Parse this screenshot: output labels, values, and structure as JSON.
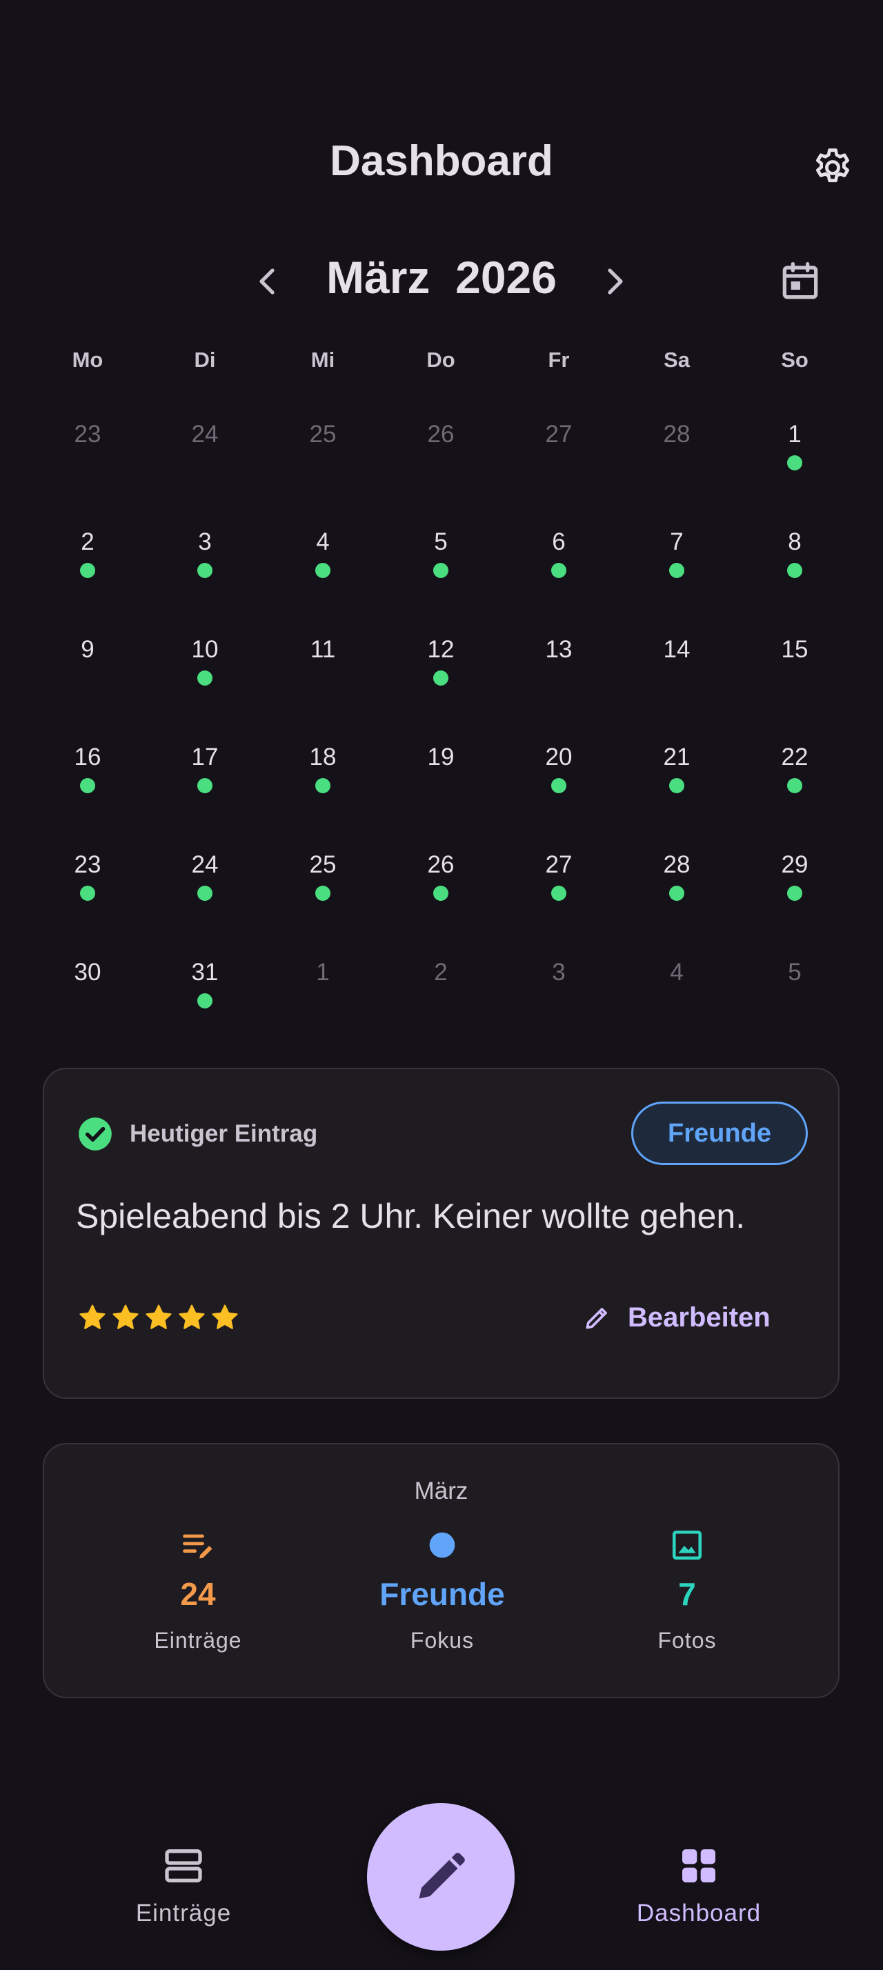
{
  "header": {
    "title": "Dashboard",
    "settings_icon": "gear-icon"
  },
  "month_nav": {
    "month": "März",
    "year": "2026",
    "prev_icon": "chevron-left-icon",
    "next_icon": "chevron-right-icon",
    "calendar_icon": "calendar-icon"
  },
  "calendar": {
    "weekdays": [
      "Mo",
      "Di",
      "Mi",
      "Do",
      "Fr",
      "Sa",
      "So"
    ],
    "entry_dot_color": "#4ade80",
    "weeks": [
      [
        {
          "d": "23",
          "other": true,
          "dot": false
        },
        {
          "d": "24",
          "other": true,
          "dot": false
        },
        {
          "d": "25",
          "other": true,
          "dot": false
        },
        {
          "d": "26",
          "other": true,
          "dot": false
        },
        {
          "d": "27",
          "other": true,
          "dot": false
        },
        {
          "d": "28",
          "other": true,
          "dot": false
        },
        {
          "d": "1",
          "other": false,
          "dot": true
        }
      ],
      [
        {
          "d": "2",
          "other": false,
          "dot": true
        },
        {
          "d": "3",
          "other": false,
          "dot": true
        },
        {
          "d": "4",
          "other": false,
          "dot": true
        },
        {
          "d": "5",
          "other": false,
          "dot": true
        },
        {
          "d": "6",
          "other": false,
          "dot": true
        },
        {
          "d": "7",
          "other": false,
          "dot": true
        },
        {
          "d": "8",
          "other": false,
          "dot": true
        }
      ],
      [
        {
          "d": "9",
          "other": false,
          "dot": false
        },
        {
          "d": "10",
          "other": false,
          "dot": true
        },
        {
          "d": "11",
          "other": false,
          "dot": false
        },
        {
          "d": "12",
          "other": false,
          "dot": true
        },
        {
          "d": "13",
          "other": false,
          "dot": false
        },
        {
          "d": "14",
          "other": false,
          "dot": false
        },
        {
          "d": "15",
          "other": false,
          "dot": false
        }
      ],
      [
        {
          "d": "16",
          "other": false,
          "dot": true
        },
        {
          "d": "17",
          "other": false,
          "dot": true
        },
        {
          "d": "18",
          "other": false,
          "dot": true
        },
        {
          "d": "19",
          "other": false,
          "dot": false
        },
        {
          "d": "20",
          "other": false,
          "dot": true
        },
        {
          "d": "21",
          "other": false,
          "dot": true
        },
        {
          "d": "22",
          "other": false,
          "dot": true
        }
      ],
      [
        {
          "d": "23",
          "other": false,
          "dot": true
        },
        {
          "d": "24",
          "other": false,
          "dot": true
        },
        {
          "d": "25",
          "other": false,
          "dot": true
        },
        {
          "d": "26",
          "other": false,
          "dot": true
        },
        {
          "d": "27",
          "other": false,
          "dot": true
        },
        {
          "d": "28",
          "other": false,
          "dot": true
        },
        {
          "d": "29",
          "other": false,
          "dot": true
        }
      ],
      [
        {
          "d": "30",
          "other": false,
          "dot": false
        },
        {
          "d": "31",
          "other": false,
          "dot": true
        },
        {
          "d": "1",
          "other": true,
          "dot": false
        },
        {
          "d": "2",
          "other": true,
          "dot": false
        },
        {
          "d": "3",
          "other": true,
          "dot": false
        },
        {
          "d": "4",
          "other": true,
          "dot": false
        },
        {
          "d": "5",
          "other": true,
          "dot": false
        }
      ]
    ]
  },
  "today_entry": {
    "header_label": "Heutiger Eintrag",
    "check_icon": "check-circle-icon",
    "tag": "Freunde",
    "text": "Spieleabend bis 2 Uhr. Keiner wollte gehen.",
    "rating": 5,
    "rating_max": 5,
    "edit_label": "Bearbeiten",
    "edit_icon": "pencil-icon"
  },
  "month_stats": {
    "title": "März",
    "items": [
      {
        "icon": "notes-edit-icon",
        "value": "24",
        "label": "Einträge",
        "color": "#f2994a"
      },
      {
        "icon": "dot-icon",
        "value": "Freunde",
        "label": "Fokus",
        "color": "#60a5fa"
      },
      {
        "icon": "image-icon",
        "value": "7",
        "label": "Fotos",
        "color": "#2dd4bf"
      }
    ]
  },
  "bottom_nav": {
    "entries_label": "Einträge",
    "entries_icon": "list-rows-icon",
    "dashboard_label": "Dashboard",
    "dashboard_icon": "grid-icon",
    "fab_icon": "pencil-icon",
    "active_color": "#d0bcff",
    "inactive_color": "#cac4d0"
  }
}
